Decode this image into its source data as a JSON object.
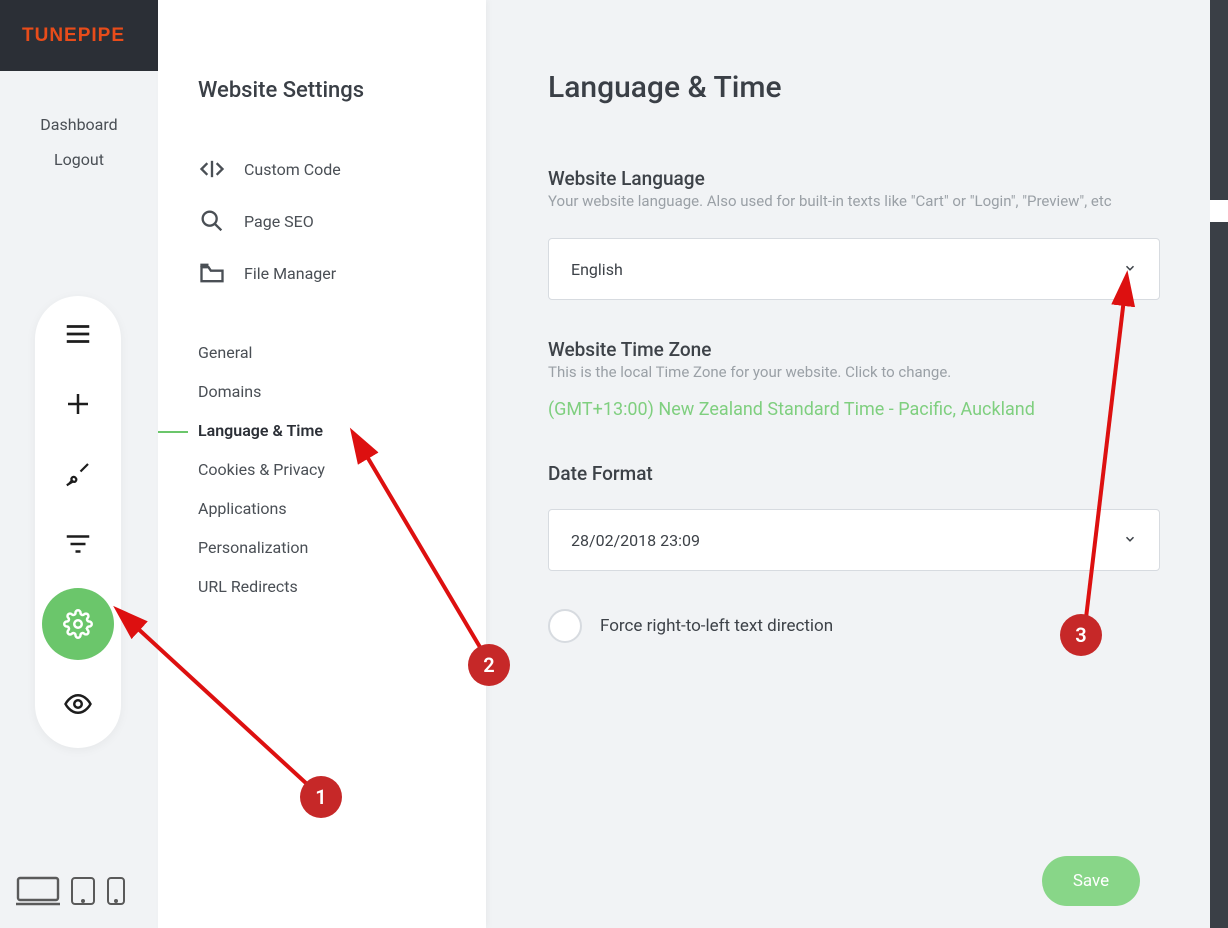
{
  "brand": "TUNEPIPE",
  "left_links": {
    "dashboard": "Dashboard",
    "logout": "Logout"
  },
  "tool_icons": [
    "menu",
    "plus",
    "brush",
    "filter",
    "gear",
    "eye"
  ],
  "devices": [
    "desktop",
    "tablet",
    "mobile"
  ],
  "settings": {
    "title": "Website Settings",
    "iconItems": [
      {
        "id": "custom-code",
        "label": "Custom Code"
      },
      {
        "id": "page-seo",
        "label": "Page SEO"
      },
      {
        "id": "file-manager",
        "label": "File Manager"
      }
    ],
    "plainItems": [
      {
        "id": "general",
        "label": "General"
      },
      {
        "id": "domains",
        "label": "Domains"
      },
      {
        "id": "language-time",
        "label": "Language & Time",
        "active": true
      },
      {
        "id": "cookies-privacy",
        "label": "Cookies & Privacy"
      },
      {
        "id": "applications",
        "label": "Applications"
      },
      {
        "id": "personalization",
        "label": "Personalization"
      },
      {
        "id": "url-redirects",
        "label": "URL Redirects"
      }
    ]
  },
  "page": {
    "title": "Language & Time",
    "lang_label": "Website Language",
    "lang_desc": "Your website language. Also used for built-in texts like \"Cart\" or \"Login\", \"Preview\", etc",
    "lang_value": "English",
    "tz_label": "Website Time Zone",
    "tz_desc": "This is the local Time Zone for your website. Click to change.",
    "tz_value": "(GMT+13:00) New Zealand Standard Time - Pacific, Auckland",
    "date_label": "Date Format",
    "date_value": "28/02/2018 23:09",
    "rtl_label": "Force right-to-left text direction",
    "save": "Save"
  },
  "annotations": [
    "1",
    "2",
    "3"
  ]
}
